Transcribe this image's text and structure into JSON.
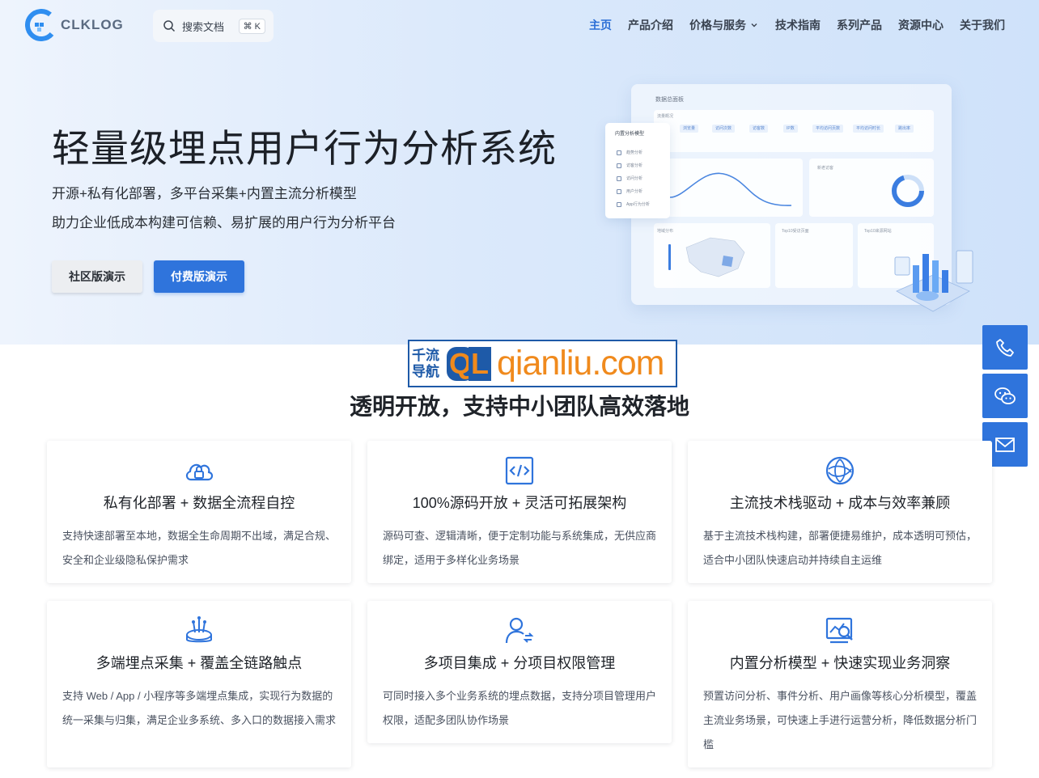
{
  "header": {
    "logo_text": "CLKLOG",
    "search": {
      "placeholder": "搜索文档",
      "shortcut": "⌘ K"
    },
    "nav": [
      {
        "label": "主页",
        "active": true
      },
      {
        "label": "产品介绍"
      },
      {
        "label": "价格与服务",
        "dropdown": true
      },
      {
        "label": "技术指南"
      },
      {
        "label": "系列产品"
      },
      {
        "label": "资源中心"
      },
      {
        "label": "关于我们"
      }
    ]
  },
  "hero": {
    "title": "轻量级埋点用户行为分析系统",
    "subtitle1": "开源+私有化部署，多平台采集+内置主流分析模型",
    "subtitle2": "助力企业低成本构建可信赖、易扩展的用户行为分析平台",
    "btn_community": "社区版演示",
    "btn_paid": "付费版演示"
  },
  "dashboard": {
    "title": "数据总面板",
    "overview": "流量概况",
    "chips": [
      "浏览量",
      "访问次数",
      "访客数",
      "IP数",
      "平均访问页数",
      "平均访问时长",
      "跳出率"
    ],
    "panel_new_old": "新老访客",
    "panel_region": "地域分布",
    "panel_pages": "Top10受访页面",
    "panel_sources": "Top10来源网站",
    "menu_title": "内置分析模型",
    "menu_items": [
      "趋势分析",
      "访客分析",
      "访问分析",
      "用户分析",
      "App行为分析"
    ]
  },
  "watermark": {
    "cn_line1": "千流",
    "cn_line2": "导航",
    "q": "Q",
    "l": "L",
    "url": "qianliu.com"
  },
  "section": {
    "title": "透明开放，支持中小团队高效落地",
    "cards": [
      {
        "icon": "cloud-lock-icon",
        "title": "私有化部署 + 数据全流程自控",
        "desc": "支持快速部署至本地，数据全生命周期不出域，满足合规、安全和企业级隐私保护需求"
      },
      {
        "icon": "code-icon",
        "title": "100%源码开放 + 灵活可拓展架构",
        "desc": "源码可查、逻辑清晰，便于定制功能与系统集成，无供应商绑定，适用于多样化业务场景"
      },
      {
        "icon": "tech-stack-icon",
        "title": "主流技术栈驱动 + 成本与效率兼顾",
        "desc": "基于主流技术栈构建，部署便捷易维护，成本透明可预估，适合中小团队快速启动并持续自主运维"
      },
      {
        "icon": "multi-collect-icon",
        "title": "多端埋点采集 + 覆盖全链路触点",
        "desc": "支持 Web / App / 小程序等多端埋点集成，实现行为数据的统一采集与归集，满足企业多系统、多入口的数据接入需求"
      },
      {
        "icon": "user-permission-icon",
        "title": "多项目集成 + 分项目权限管理",
        "desc": "可同时接入多个业务系统的埋点数据，支持分项目管理用户权限，适配多团队协作场景"
      },
      {
        "icon": "analysis-model-icon",
        "title": "内置分析模型 + 快速实现业务洞察",
        "desc": "预置访问分析、事件分析、用户画像等核心分析模型，覆盖主流业务场景，可快速上手进行运营分析，降低数据分析门槛"
      }
    ]
  },
  "side_contact": [
    "phone-icon",
    "wechat-icon",
    "mail-icon"
  ],
  "colors": {
    "primary": "#2f74dc",
    "hero_bg": "#dbe9fb",
    "watermark_blue": "#1e5aa8",
    "watermark_orange": "#f08a1d"
  }
}
